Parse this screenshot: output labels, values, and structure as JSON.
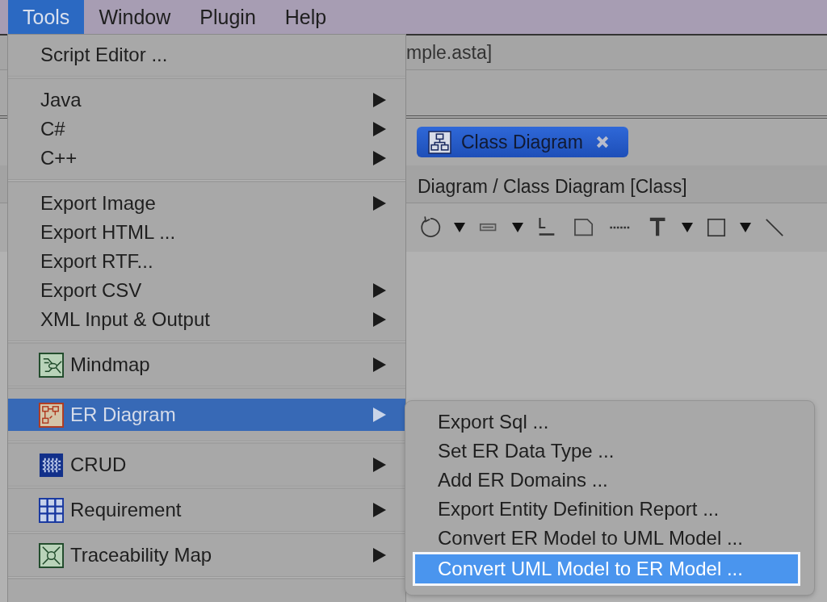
{
  "menu_bar": [
    {
      "label": "Tools",
      "selected": true
    },
    {
      "label": "Window",
      "selected": false
    },
    {
      "label": "Plugin",
      "selected": false
    },
    {
      "label": "Help",
      "selected": false
    }
  ],
  "window": {
    "title_fragments": [
      "mple.asta]"
    ],
    "tab": {
      "label": "Class Diagram",
      "selected": true
    },
    "breadcrumb": "Diagram / Class Diagram [Class]"
  },
  "tools_menu": {
    "sections": [
      [
        {
          "label": "Script Editor ...",
          "submenu": false,
          "selected": false
        }
      ],
      [
        {
          "label": "Java",
          "submenu": true,
          "selected": false
        },
        {
          "label": "C#",
          "submenu": true,
          "selected": false
        },
        {
          "label": "C++",
          "submenu": true,
          "selected": false
        }
      ],
      [
        {
          "label": "Export Image",
          "submenu": true,
          "selected": false
        },
        {
          "label": "Export HTML ...",
          "submenu": false,
          "selected": false
        },
        {
          "label": "Export RTF...",
          "submenu": false,
          "selected": false
        },
        {
          "label": "Export CSV",
          "submenu": true,
          "selected": false
        },
        {
          "label": "XML Input & Output",
          "submenu": true,
          "selected": false
        }
      ],
      [
        {
          "label": "Mindmap",
          "kind": "icon",
          "submenu": true,
          "selected": false
        }
      ],
      [
        {
          "label": "ER Diagram",
          "kind": "icon",
          "submenu": true,
          "selected": true
        }
      ],
      [
        {
          "label": "CRUD",
          "kind": "icon",
          "submenu": true,
          "selected": false
        }
      ],
      [
        {
          "label": "Requirement",
          "kind": "icon",
          "submenu": true,
          "selected": false
        }
      ],
      [
        {
          "label": "Traceability Map",
          "kind": "icon",
          "submenu": true,
          "selected": false
        }
      ]
    ]
  },
  "er_submenu": [
    {
      "label": "Export Sql ...",
      "selected": false
    },
    {
      "label": "Set ER Data Type ...",
      "selected": false
    },
    {
      "label": "Add ER Domains ...",
      "selected": false
    },
    {
      "label": "Export Entity Definition Report ...",
      "selected": false
    },
    {
      "label": "Convert ER Model to UML Model ...",
      "selected": false
    },
    {
      "label": "Convert UML Model to ER Model ...",
      "selected": true
    }
  ]
}
